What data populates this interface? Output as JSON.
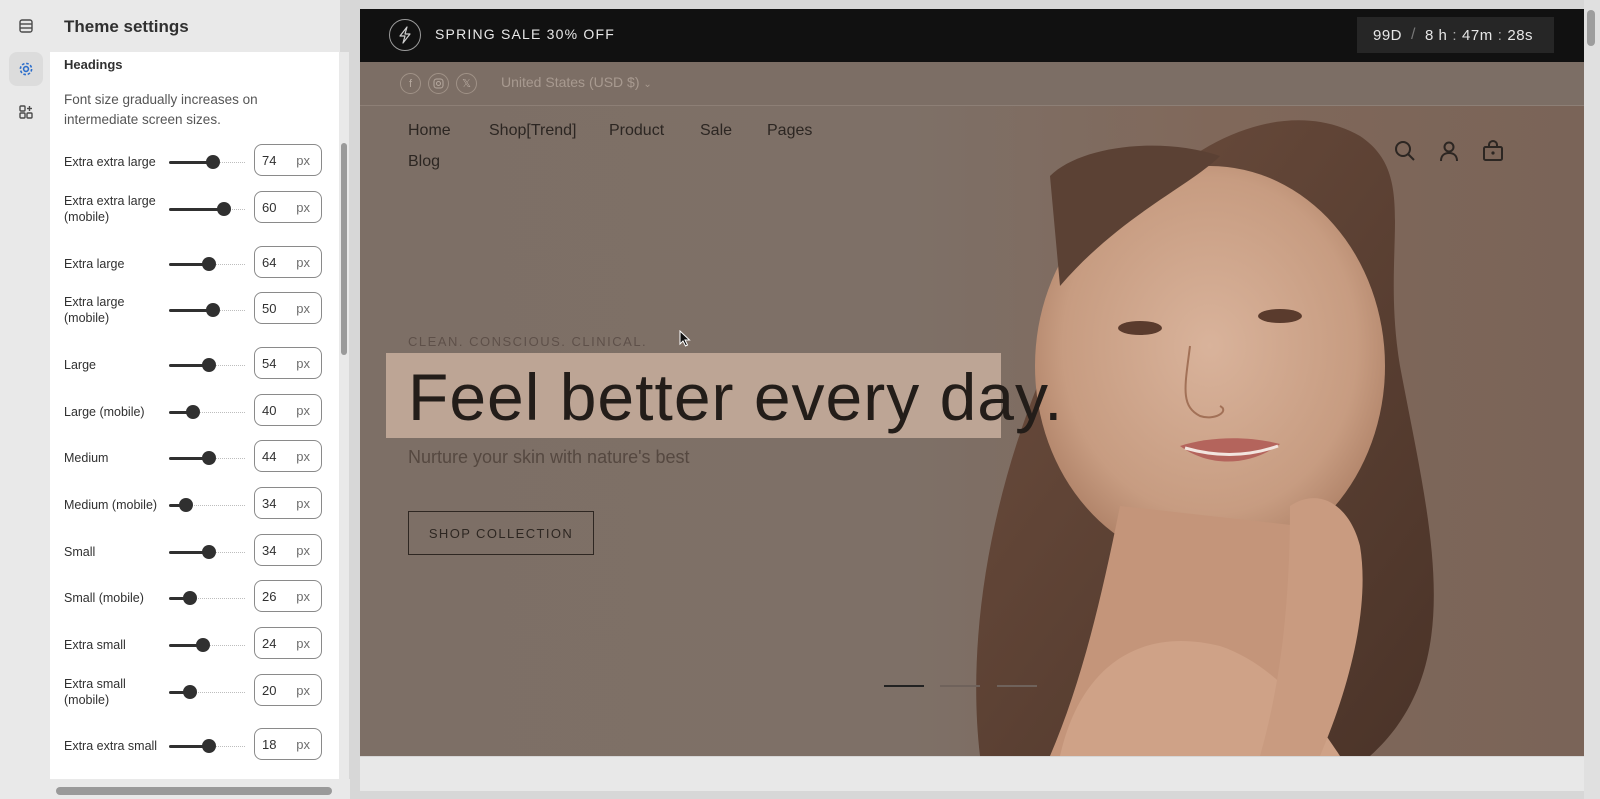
{
  "panel": {
    "title": "Theme settings",
    "section_title": "Headings",
    "section_desc": "Font size gradually increases on intermediate screen sizes.",
    "unit": "px",
    "rows": [
      {
        "label": "Extra extra large",
        "value": "74",
        "level": 0.58
      },
      {
        "label": "Extra extra large (mobile)",
        "value": "60",
        "level": 0.73
      },
      {
        "label": "Extra large",
        "value": "64",
        "level": 0.53
      },
      {
        "label": "Extra large (mobile)",
        "value": "50",
        "level": 0.58
      },
      {
        "label": "Large",
        "value": "54",
        "level": 0.53
      },
      {
        "label": "Large (mobile)",
        "value": "40",
        "level": 0.32
      },
      {
        "label": "Medium",
        "value": "44",
        "level": 0.53
      },
      {
        "label": "Medium (mobile)",
        "value": "34",
        "level": 0.22
      },
      {
        "label": "Small",
        "value": "34",
        "level": 0.53
      },
      {
        "label": "Small (mobile)",
        "value": "26",
        "level": 0.28
      },
      {
        "label": "Extra small",
        "value": "24",
        "level": 0.45
      },
      {
        "label": "Extra small (mobile)",
        "value": "20",
        "level": 0.28
      },
      {
        "label": "Extra extra small",
        "value": "18",
        "level": 0.52
      }
    ]
  },
  "rail": {
    "icons": [
      "sections-icon",
      "theme-settings-icon",
      "apps-icon"
    ],
    "active": "theme-settings-icon"
  },
  "preview": {
    "announcement": "SPRING SALE 30% OFF",
    "countdown": {
      "days": "99D",
      "hours": "8 h",
      "minutes": "47m",
      "seconds": "28s"
    },
    "currency": "United States (USD $)",
    "social": [
      "facebook-icon",
      "instagram-icon",
      "x-icon"
    ],
    "nav": [
      "Home",
      "Shop[Trend]",
      "Product",
      "Sale",
      "Pages",
      "Blog"
    ],
    "eyebrow": "CLEAN. CONSCIOUS. CLINICAL.",
    "headline": "Feel better every day.",
    "subheadline": "Nurture your skin with nature's best",
    "cta": "SHOP COLLECTION",
    "slides": 3,
    "active_slide": 1
  },
  "colors": {
    "accent": "#303030",
    "announcement_bg": "#111111"
  }
}
